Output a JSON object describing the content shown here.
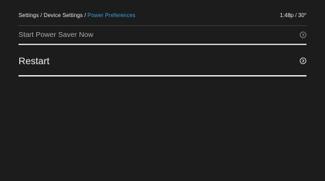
{
  "breadcrumb": {
    "items": [
      "Settings",
      "Device Settings"
    ],
    "separator": " / ",
    "current": "Power Preferences"
  },
  "status": {
    "time_weather": "1:48p / 30°"
  },
  "menu": {
    "items": [
      {
        "label": "Start Power Saver Now",
        "icon": "chevron-right-circle-icon"
      },
      {
        "label": "Restart",
        "icon": "chevron-right-circle-icon"
      }
    ]
  },
  "colors": {
    "background": "#1c1c1c",
    "accent": "#3aa0e0",
    "text": "#e9e9e9",
    "dim_text": "#a9a9a9"
  }
}
